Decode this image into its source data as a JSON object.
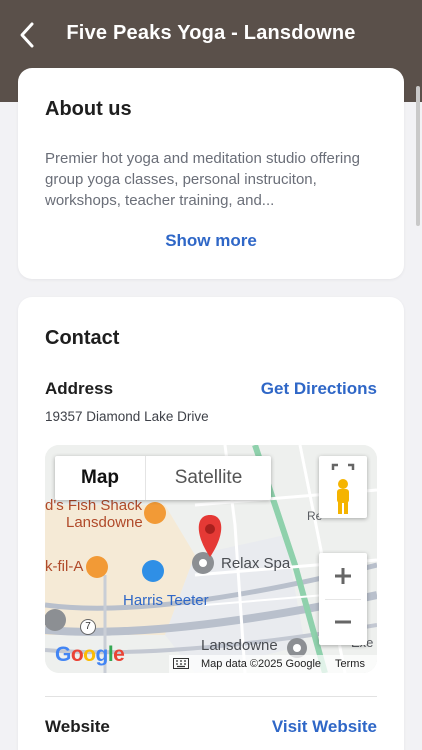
{
  "header": {
    "title": "Five Peaks Yoga - Lansdowne"
  },
  "about": {
    "heading": "About us",
    "description": "Premier hot yoga and meditation studio offering group yoga classes, personal instruciton, workshops, teacher training, and...",
    "show_more": "Show more"
  },
  "contact": {
    "heading": "Contact",
    "address_label": "Address",
    "directions": "Get Directions",
    "address": "19357 Diamond Lake Drive",
    "website_label": "Website",
    "visit": "Visit Website"
  },
  "map": {
    "map_tab": "Map",
    "satellite_tab": "Satellite",
    "labels": [
      "d's Fish Shack",
      "Lansdowne",
      "k-fil-A",
      "Harris Teeter",
      "Relax Spa",
      "Lansdowne",
      "Exe",
      "Re",
      "7"
    ],
    "attribution": "Map data ©2025 Google",
    "terms": "Terms",
    "google": [
      "G",
      "o",
      "o",
      "g",
      "l",
      "e"
    ]
  },
  "colors": {
    "header": "#5a504a",
    "link": "#2f67c7",
    "pin": "#e53935",
    "route": "#8fd1ac"
  }
}
